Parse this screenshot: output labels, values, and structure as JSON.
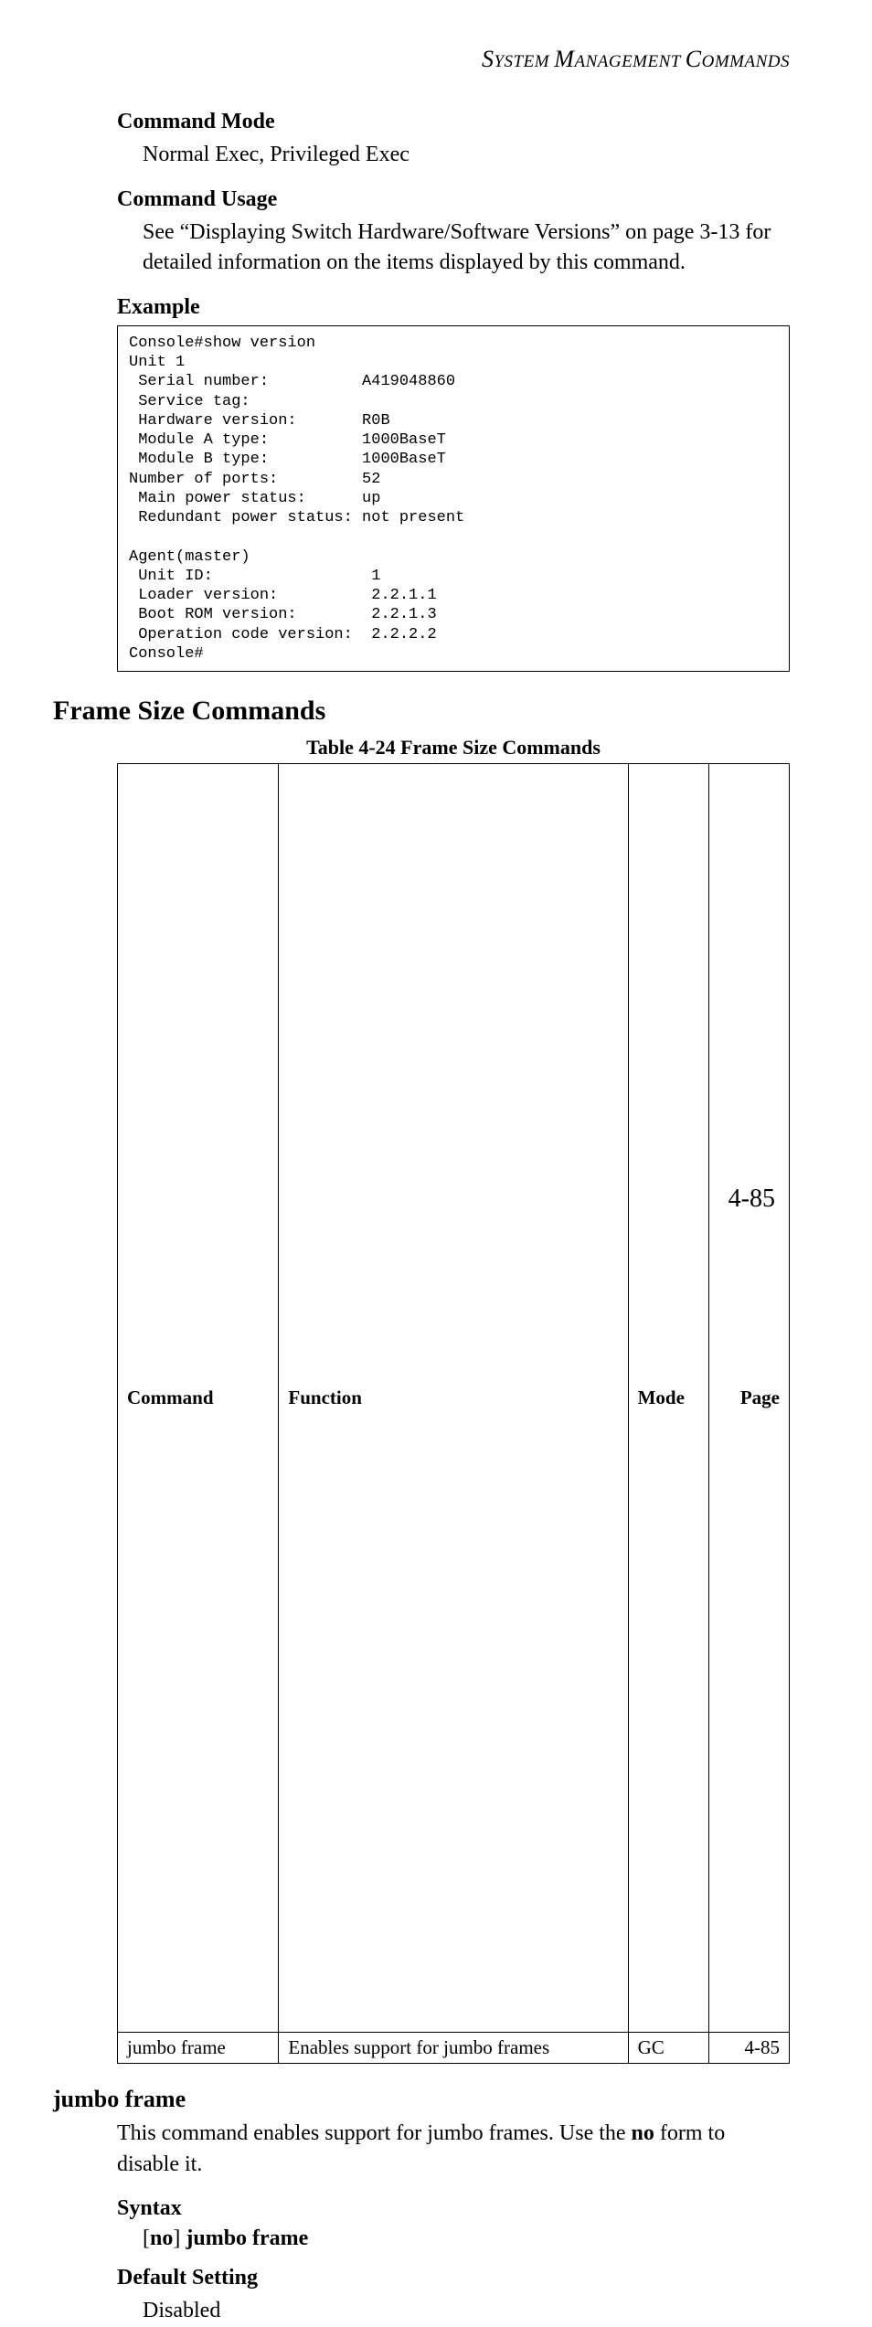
{
  "running_head_prefix": "S",
  "running_head_middle": "YSTEM ",
  "running_head_m": "M",
  "running_head_mgmt": "ANAGEMENT ",
  "running_head_c": "C",
  "running_head_cmds": "OMMANDS",
  "headings": {
    "command_mode": "Command Mode",
    "normal_exec": "Normal Exec, Privileged Exec",
    "command_usage": "Command Usage",
    "usage_text": "See “Displaying Switch Hardware/Software Versions” on page 3-13 for detailed information on the items displayed by this command.",
    "example": "Example",
    "frame_size_commands": "Frame Size Commands",
    "table_caption": "Table 4-24  Frame Size Commands",
    "jumbo_frame": "jumbo frame",
    "jumbo_desc_pre": "This command enables support for jumbo frames. Use the ",
    "jumbo_desc_bold": "no",
    "jumbo_desc_post": " form to disable it.",
    "syntax": "Syntax",
    "syntax_no": "no",
    "syntax_jumbo": "jumbo frame",
    "default_setting": "Default Setting",
    "disabled": "Disabled",
    "page_number": "4-85"
  },
  "console": {
    "line1": "Console#show version",
    "line2": "Unit 1",
    "line3": " Serial number:          A419048860",
    "line4": " Service tag:",
    "line5": " Hardware version:       R0B",
    "line6": " Module A type:          1000BaseT",
    "line7": " Module B type:          1000BaseT",
    "line8": "Number of ports:         52",
    "line9": " Main power status:      up",
    "line10": " Redundant power status: not present",
    "line11": "",
    "line12": "Agent(master)",
    "line13": " Unit ID:                 1",
    "line14": " Loader version:          2.2.1.1",
    "line15": " Boot ROM version:        2.2.1.3",
    "line16": " Operation code version:  2.2.2.2",
    "line17": "Console#"
  },
  "table": {
    "h_command": "Command",
    "h_function": "Function",
    "h_mode": "Mode",
    "h_page": "Page",
    "r1_command": "jumbo frame",
    "r1_function": "Enables support for jumbo frames",
    "r1_mode": "GC",
    "r1_page": "4-85"
  }
}
